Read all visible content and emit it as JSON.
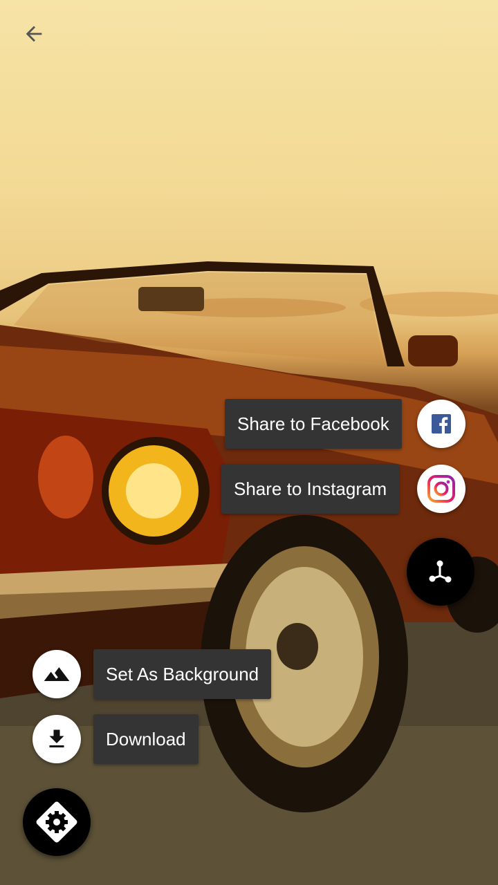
{
  "top_bar": {
    "back_icon": "arrow-back-icon"
  },
  "share_menu": {
    "facebook_label": "Share to Facebook",
    "instagram_label": "Share to Instagram",
    "facebook_icon": "facebook-icon",
    "instagram_icon": "instagram-icon",
    "toggle_icon": "share-icon"
  },
  "action_menu": {
    "background_label": "Set As Background",
    "download_label": "Download",
    "background_icon": "landscape-icon",
    "download_icon": "download-icon",
    "toggle_icon": "settings-icon"
  },
  "colors": {
    "label_bg": "#343434",
    "fab_dark": "#000000",
    "fab_light": "#ffffff",
    "facebook_blue": "#3b5998"
  }
}
